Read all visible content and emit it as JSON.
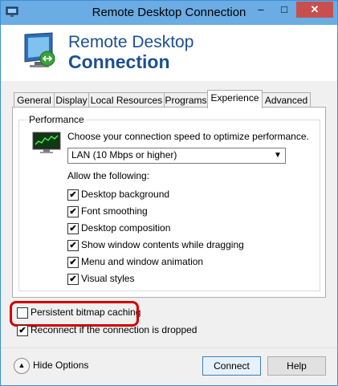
{
  "window": {
    "title": "Remote Desktop Connection"
  },
  "titlebar": {
    "minimize": "–",
    "maximize": "□",
    "close": "✕"
  },
  "header": {
    "line1": "Remote Desktop",
    "line2": "Connection"
  },
  "tabs": [
    "General",
    "Display",
    "Local Resources",
    "Programs",
    "Experience",
    "Advanced"
  ],
  "active_tab": "Experience",
  "performance": {
    "group_label": "Performance",
    "choose_text": "Choose your connection speed to optimize performance.",
    "speed_value": "LAN (10 Mbps or higher)",
    "allow_text": "Allow the following:",
    "options": [
      {
        "label": "Desktop background",
        "checked": true
      },
      {
        "label": "Font smoothing",
        "checked": true
      },
      {
        "label": "Desktop composition",
        "checked": true
      },
      {
        "label": "Show window contents while dragging",
        "checked": true
      },
      {
        "label": "Menu and window animation",
        "checked": true
      },
      {
        "label": "Visual styles",
        "checked": true
      }
    ]
  },
  "persistent": {
    "label": "Persistent bitmap caching",
    "checked": false
  },
  "reconnect": {
    "label": "Reconnect if the connection is dropped",
    "checked": true
  },
  "footer": {
    "hide_options": "Hide Options",
    "connect": "Connect",
    "help": "Help"
  },
  "check_glyph": "✔",
  "colors": {
    "titlebar": "#6aace3",
    "header_text": "#1c4f92",
    "close_button": "#c7504f",
    "highlight": "#d00000"
  }
}
